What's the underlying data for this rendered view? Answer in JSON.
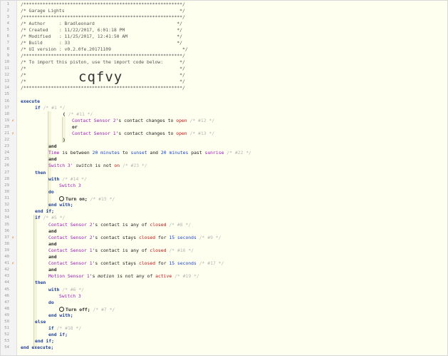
{
  "editor": {
    "header_rule": "/**********************************************************/",
    "header_title": "/* Garage Lights                                          */",
    "author": "/* Author     : Bradleonard                              */",
    "created": "/* Created    : 11/22/2017, 6:01:18 PM                   */",
    "modified": "/* Modified   : 11/25/2017, 12:41:50 AM                  */",
    "build": "/* Build      : 33                                       */",
    "ui_version": "/* UI version : v0.2.0fe.20171109                          */",
    "import_note": "/* To import this piston, use the import code below:      */",
    "empty_comment": "/*                                                        */",
    "import_code": "cqfvy",
    "star_line": "/*                                                        */"
  },
  "line_numbers": [
    "1",
    "2",
    "3",
    "4",
    "5",
    "6",
    "7",
    "8",
    "9",
    "10",
    "11",
    "12",
    "13",
    "14",
    "15",
    "16",
    "17",
    "18",
    "19",
    "20",
    "21",
    "22",
    "23",
    "24",
    "25",
    "26",
    "27",
    "28",
    "29",
    "30",
    "31",
    "32",
    "33",
    "34",
    "35",
    "36",
    "37",
    "38",
    "39",
    "40",
    "41",
    "42",
    "43",
    "44",
    "45",
    "46",
    "47",
    "48",
    "49",
    "50",
    "51",
    "52",
    "53",
    "54"
  ],
  "markers": {
    "19": "⚡",
    "21": "⚡",
    "37": "⚡",
    "41": "⚡"
  },
  "code": {
    "execute": "execute",
    "if": "if",
    "c1": "/* #1 */",
    "open_paren": "(",
    "c11": "/* #11 */",
    "contact_sensor_2": "Contact Sensor 2",
    "contact_sensor_1": "Contact Sensor 1",
    "contact_changes_to": "'s contact changes to",
    "open": "open",
    "c12": "/* #12 */",
    "or": "or",
    "c13": "/* #13 */",
    "close_paren": ")",
    "and": "and",
    "time": "Time",
    "is_between": "is between",
    "twenty": "20",
    "minutes": "minutes",
    "to": "to",
    "sunset": "sunset",
    "past": "past",
    "sunrise": "sunrise",
    "c22": "/* #22 */",
    "switch_3": "Switch 3",
    "switch_3_quote": "Switch 3'",
    "switch_word": "switch",
    "is_not": "is not",
    "on": "on",
    "c23": "/* #23 */",
    "then": "then",
    "with": "with",
    "c14": "/* #14 */",
    "do": "do",
    "turn_on": "Turn on;",
    "c15": "/* #15 */",
    "end_with": "end with;",
    "end_if": "end if;",
    "c5": "/* #5 */",
    "contact_is_any_of": "'s contact is any of",
    "closed": "closed",
    "c8": "/* #8 */",
    "contact_stays": "'s contact stays",
    "for": "for",
    "fifteen": "15",
    "seconds": "seconds",
    "c9": "/* #9 */",
    "c16": "/* #16 */",
    "c17": "/* #17 */",
    "motion_sensor_1": "Motion Sensor 1",
    "motion_word": "motion",
    "is_not_any_of": "is not any of",
    "active": "active",
    "c19": "/* #19 */",
    "c6": "/* #6 */",
    "turn_off": "Turn off;",
    "c7": "/* #7 */",
    "else": "else",
    "c18": "/* #18 */",
    "end_execute": "end execute;",
    "sq": "'s"
  }
}
